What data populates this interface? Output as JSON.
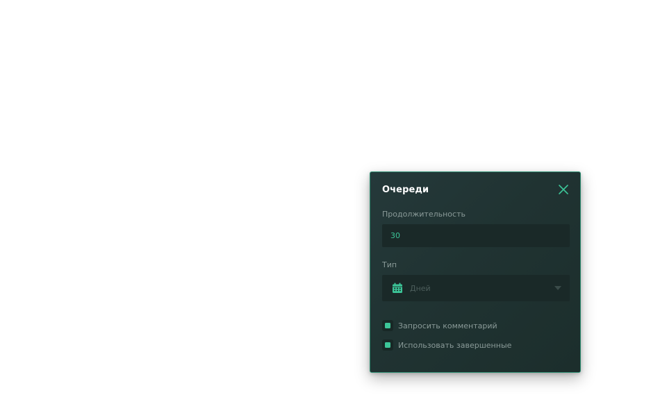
{
  "dialog": {
    "title": "Очереди",
    "close_icon": "close-icon",
    "duration": {
      "label": "Продолжительность",
      "value": "30"
    },
    "type": {
      "label": "Тип",
      "icon": "calendar-icon",
      "selected": "Дней"
    },
    "checkboxes": [
      {
        "label": "Запросить комментарий",
        "checked": true
      },
      {
        "label": "Использовать завершенные",
        "checked": true
      }
    ]
  },
  "colors": {
    "accent": "#3cc598",
    "panel": "#203332",
    "field": "#1a2928",
    "border": "#2f8f73",
    "label": "#8a9a98"
  }
}
